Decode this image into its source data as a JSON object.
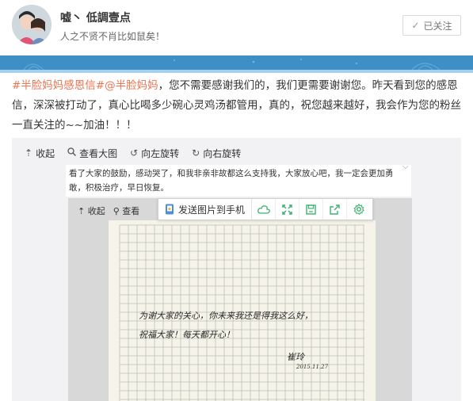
{
  "profile": {
    "username": "嘘丶 低調壹点",
    "bio": "人之不贤不肖比如鼠矣！",
    "follow_label": "已关注"
  },
  "post": {
    "tag": "#半脸妈妈感恩信#",
    "mention": "@半脸妈妈",
    "body": "，您不需要感谢我们的，我们更需要谢谢您。昨天看到您的感恩信，深深被打动了，真心比喝多少碗心灵鸡汤都管用，真的，祝您越来越好，我会作为您的粉丝一直关注的~~加油！！！"
  },
  "viewer": {
    "toolbar": {
      "collapse": "收起",
      "view_large": "查看大图",
      "rotate_left": "向左旋转",
      "rotate_right": "向右旋转"
    },
    "caption": "看了大家的鼓励，感动哭了，和我非亲非故都这么支持我，大家放心吧，我一定会更加勇敢，积极治疗，早日恢复。",
    "inner_toolbar": {
      "collapse": "收起",
      "view": "查看"
    },
    "popup": {
      "send_label": "发送图片到手机"
    }
  },
  "letter": {
    "line1": "为谢大家的关心，你未来我还是得我这么好，",
    "line2": "祝福大家！每天都开心！",
    "signature": "崔玲",
    "date": "2015.11.27"
  },
  "colors": {
    "link": "#eb7350",
    "banner": "#3d8fc6",
    "popup_icon": "#3cb371"
  },
  "icons": {
    "follow": "check-icon",
    "collapse": "arrow-up-icon",
    "view_large": "magnifier-icon",
    "rotate_left": "rotate-left-icon",
    "rotate_right": "rotate-right-icon",
    "popup": [
      "phone-icon",
      "cloud-icon",
      "fullscreen-icon",
      "save-icon",
      "share-icon",
      "settings-icon"
    ]
  }
}
